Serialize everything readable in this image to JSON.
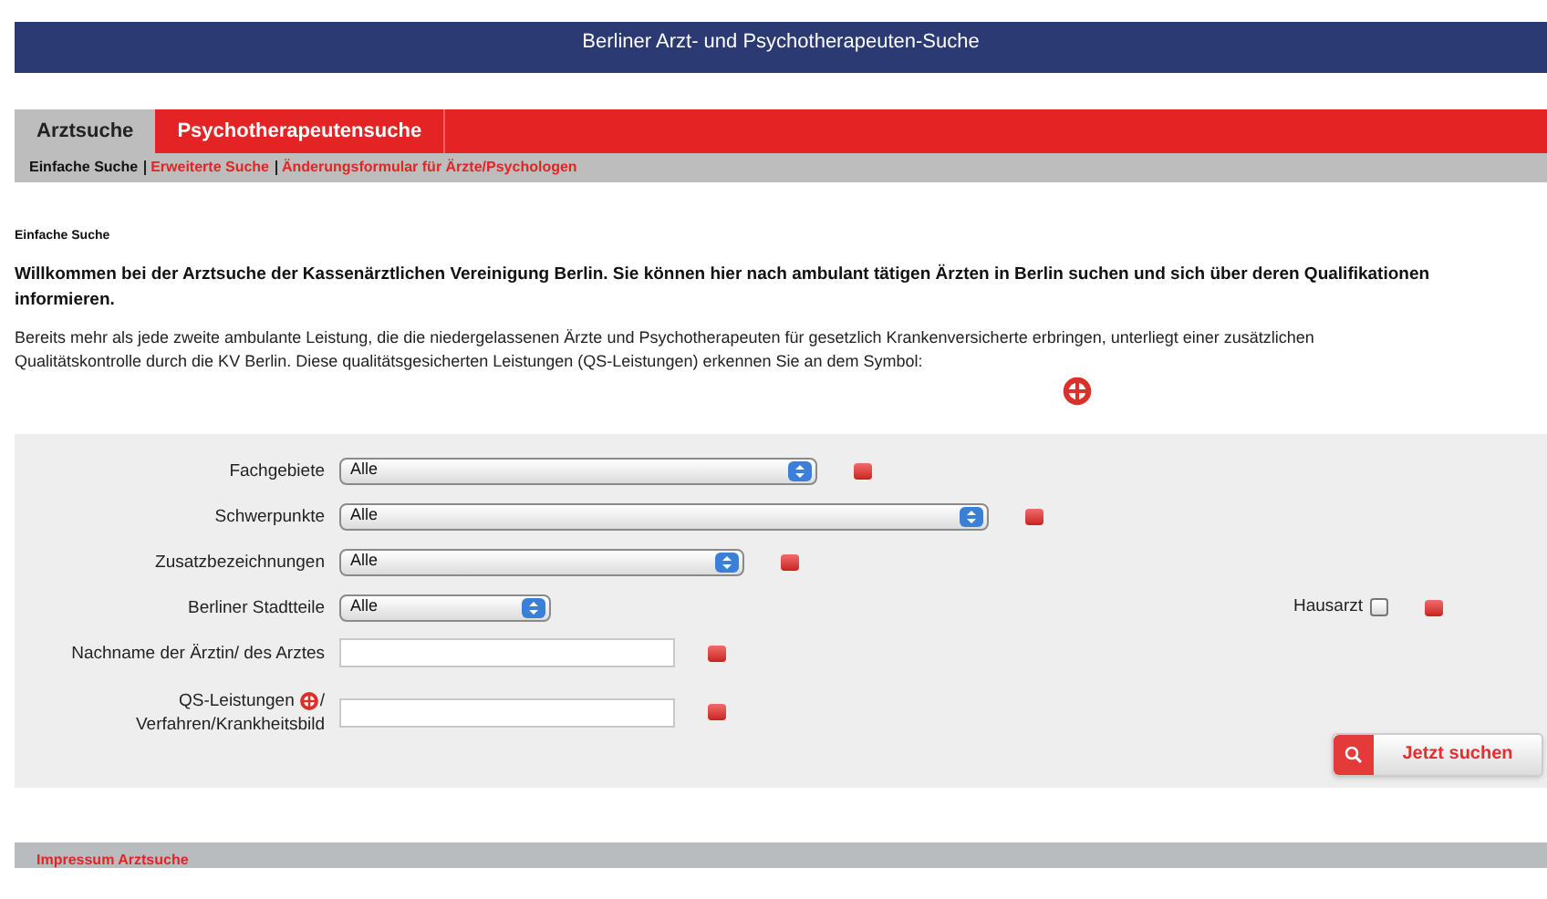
{
  "header": {
    "title": "Berliner Arzt- und Psychotherapeuten-Suche"
  },
  "tabs": [
    {
      "label": "Arztsuche",
      "selected": true
    },
    {
      "label": "Psychotherapeutensuche",
      "selected": false
    }
  ],
  "subnav": [
    {
      "label": "Einfache Suche",
      "selected": true
    },
    {
      "label": "Erweiterte Suche",
      "selected": false
    },
    {
      "label": "Änderungsformular für Ärzte/Psychologen",
      "selected": false
    }
  ],
  "section_title": "Einfache Suche",
  "intro": "Willkommen bei der Arztsuche der Kassenärztlichen Vereinigung Berlin. Sie können hier nach ambulant tätigen Ärzten in Berlin suchen und sich über deren Qualifikationen informieren.",
  "info": "Bereits mehr als jede zweite ambulante Leistung, die die niedergelassenen Ärzte und Psychotherapeuten für gesetzlich Krankenversicherte erbringen, unterliegt einer zusätzlichen Qualitätskontrolle durch die KV Berlin. Diese qualitätsgesicherten Leistungen (QS-Leistungen) erkennen Sie an dem Symbol:",
  "fields": [
    {
      "kind": "select",
      "label": "Fachgebiete",
      "value": "Alle"
    },
    {
      "kind": "select",
      "label": "Schwerpunkte",
      "value": "Alle"
    },
    {
      "kind": "select",
      "label": "Zusatzbezeichnungen",
      "value": "Alle"
    },
    {
      "kind": "select",
      "label": "Berliner Stadtteile",
      "value": "Alle"
    },
    {
      "kind": "text",
      "label": "Nachname der Ärztin/ des Arztes"
    },
    {
      "kind": "qs",
      "label": "QS-Leistungen",
      "label_suffix": "/",
      "label_line2": "Verfahren/Krankheitsbild"
    }
  ],
  "hausarzt": {
    "label": "Hausarzt",
    "checked": false
  },
  "search_button": "Jetzt suchen",
  "footer": {
    "link": "Impressum Arztsuche"
  }
}
